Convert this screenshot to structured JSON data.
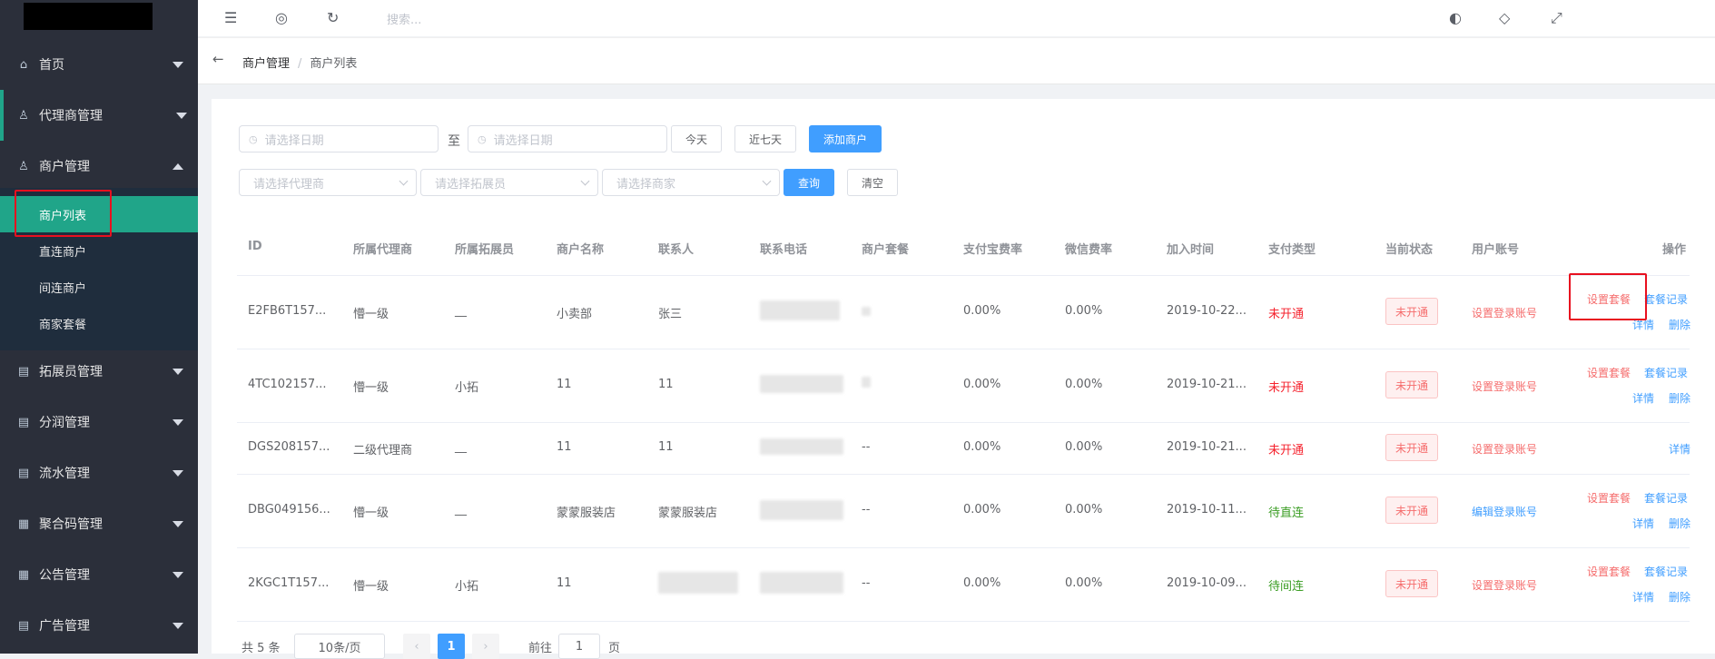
{
  "sidebar": {
    "menus": [
      {
        "label": "首页",
        "icon": "home-icon"
      },
      {
        "label": "代理商管理",
        "icon": "user-icon"
      },
      {
        "label": "商户管理",
        "icon": "user-icon"
      },
      {
        "label": "拓展员管理",
        "icon": "clipboard-icon"
      },
      {
        "label": "分润管理",
        "icon": "clipboard-icon"
      },
      {
        "label": "流水管理",
        "icon": "clipboard-icon"
      },
      {
        "label": "聚合码管理",
        "icon": "grid-icon"
      },
      {
        "label": "公告管理",
        "icon": "grid-icon"
      },
      {
        "label": "广告管理",
        "icon": "clipboard-icon"
      }
    ],
    "submenu": [
      {
        "label": "商户列表"
      },
      {
        "label": "直连商户"
      },
      {
        "label": "间连商户"
      },
      {
        "label": "商家套餐"
      }
    ]
  },
  "topbar": {
    "search_placeholder": "搜索..."
  },
  "breadcrumb": {
    "parent": "商户管理",
    "separator": "/",
    "current": "商户列表"
  },
  "filters": {
    "start_date_placeholder": "请选择日期",
    "to_label": "至",
    "end_date_placeholder": "请选择日期",
    "today_label": "今天",
    "last7_label": "近七天",
    "add_label": "添加商户",
    "agent_placeholder": "请选择代理商",
    "expander_placeholder": "请选择拓展员",
    "merchant_placeholder": "请选择商家",
    "query_label": "查询",
    "clear_label": "清空"
  },
  "table": {
    "headers": [
      "ID",
      "所属代理商",
      "所属拓展员",
      "商户名称",
      "联系人",
      "联系电话",
      "商户套餐",
      "支付宝费率",
      "微信费率",
      "加入时间",
      "支付类型",
      "当前状态",
      "用户账号",
      "操作"
    ],
    "rows": [
      {
        "id": "E2FB6T157...",
        "agent": "懵一级",
        "expander": "__",
        "name": "小卖部",
        "contact": "张三",
        "phone_suffix": "",
        "package": "",
        "alipay": "0.00%",
        "wechat": "0.00%",
        "joined": "2019-10-22...",
        "pay_type": "未开通",
        "status": "未开通",
        "account": "设置登录账号",
        "op_set": "设置套餐",
        "op_record": "套餐记录",
        "op_detail": "详情",
        "op_delete": "删除"
      },
      {
        "id": "4TC102157...",
        "agent": "懵一级",
        "expander": "小拓",
        "name": "11",
        "contact": "11",
        "phone_suffix": "",
        "package": "",
        "alipay": "0.00%",
        "wechat": "0.00%",
        "joined": "2019-10-21...",
        "pay_type": "未开通",
        "status": "未开通",
        "account": "设置登录账号",
        "op_set": "设置套餐",
        "op_record": "套餐记录",
        "op_detail": "详情",
        "op_delete": "删除"
      },
      {
        "id": "DGS208157...",
        "agent": "二级代理商",
        "expander": "__",
        "name": "11",
        "contact": "11",
        "phone_suffix": "",
        "package": "--",
        "alipay": "0.00%",
        "wechat": "0.00%",
        "joined": "2019-10-21...",
        "pay_type": "未开通",
        "status": "未开通",
        "account": "设置登录账号",
        "op_detail": "详情"
      },
      {
        "id": "DBG049156...",
        "agent": "懵一级",
        "expander": "__",
        "name": "蒙蒙服装店",
        "contact": "蒙蒙服装店",
        "phone_suffix": "",
        "package": "--",
        "alipay": "0.00%",
        "wechat": "0.00%",
        "joined": "2019-10-11...",
        "pay_type": "待直连",
        "status": "未开通",
        "account": "编辑登录账号",
        "op_set": "设置套餐",
        "op_record": "套餐记录",
        "op_detail": "详情",
        "op_delete": "删除"
      },
      {
        "id": "2KGC1T157...",
        "agent": "懵一级",
        "expander": "小拓",
        "name": "11",
        "contact": "",
        "phone_suffix": "",
        "package": "--",
        "alipay": "0.00%",
        "wechat": "0.00%",
        "joined": "2019-10-09...",
        "pay_type": "待间连",
        "status": "未开通",
        "account": "设置登录账号",
        "op_set": "设置套餐",
        "op_record": "套餐记录",
        "op_detail": "详情",
        "op_delete": "删除"
      }
    ]
  },
  "pagination": {
    "total": "共 5 条",
    "page_size": "10条/页",
    "current_page": "1",
    "goto_label": "前往",
    "goto_value": "1",
    "page_unit": "页"
  },
  "colors": {
    "sidebar_bg": "#2b2f3a",
    "active_green": "#20a589",
    "primary_blue": "#409eff",
    "danger_red": "#f56c6c",
    "highlight_box": "#e8101f"
  }
}
